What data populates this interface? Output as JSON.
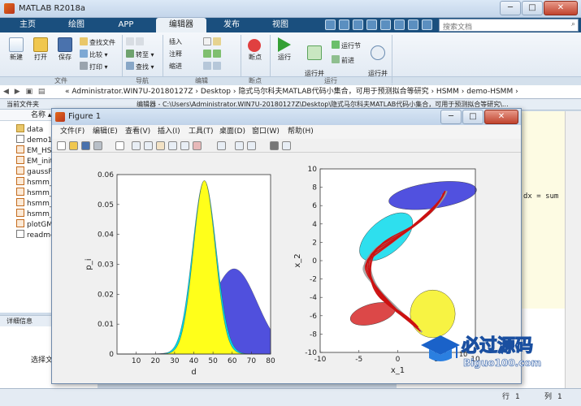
{
  "app": {
    "title": "MATLAB R2018a",
    "win_min": "─",
    "win_max": "□",
    "win_close": "✕"
  },
  "tabs": [
    "主页",
    "绘图",
    "APP",
    "编辑器",
    "发布",
    "视图"
  ],
  "search": {
    "placeholder": "搜索文档",
    "icon": "search-icon"
  },
  "ribbon": {
    "file": {
      "new": "新建",
      "open": "打开",
      "save": "保存",
      "find_files": "查找文件",
      "compare": "比较",
      "print": "打印",
      "label": "文件"
    },
    "nav": {
      "goto": "转至",
      "find": "查找",
      "label": "导航"
    },
    "edit": {
      "insert": "插入",
      "comment": "注释",
      "indent": "缩进",
      "label": "编辑"
    },
    "breakpoint": {
      "breakpoints": "断点",
      "label": "断点"
    },
    "run": {
      "run": "运行",
      "run_advance": "运行并\n前进",
      "run_section": "运行节",
      "advance": "前进",
      "run_time": "运行并\n计时",
      "label": "运行"
    }
  },
  "address": {
    "path": "« Administrator.WIN7U-20180127Z › Desktop › 隐式马尔科夫MATLAB代码小集合，可用于预测拟合等研究 › HSMM › demo-HSMM ›"
  },
  "folder": {
    "header": "当前文件夹",
    "col_name": "名称",
    "items": [
      {
        "name": "data",
        "kind": "folder"
      },
      {
        "name": "demo1",
        "kind": "file"
      },
      {
        "name": "EM_HS",
        "kind": "mat"
      },
      {
        "name": "EM_init",
        "kind": "mat"
      },
      {
        "name": "gaussP",
        "kind": "mat"
      },
      {
        "name": "hsmm_",
        "kind": "mat"
      },
      {
        "name": "hsmm_",
        "kind": "mat"
      },
      {
        "name": "hsmm_",
        "kind": "mat"
      },
      {
        "name": "hsmm_",
        "kind": "mat"
      },
      {
        "name": "plotGM",
        "kind": "mat"
      },
      {
        "name": "readme",
        "kind": "file"
      }
    ],
    "details_header": "详细信息",
    "details_text": "选择文"
  },
  "editor": {
    "tab_path": "编辑器 - C:\\Users\\Administrator.WIN7U-20180127Z\\Desktop\\隐式马尔科夫MATLAB代码小集合，可用于预测拟合等研究\\...",
    "code_snippet": "dx = sum"
  },
  "status": {
    "row_label": "行",
    "row_value": "1",
    "col_label": "列",
    "col_value": "1"
  },
  "figure": {
    "title": "Figure 1",
    "menu": [
      "文件(F)",
      "编辑(E)",
      "查看(V)",
      "插入(I)",
      "工具(T)",
      "桌面(D)",
      "窗口(W)",
      "帮助(H)"
    ]
  },
  "chart_data": [
    {
      "type": "area",
      "xlabel": "d",
      "ylabel": "p_i",
      "xlim": [
        0,
        80
      ],
      "ylim": [
        0,
        0.06
      ],
      "xticks": [
        10,
        20,
        30,
        40,
        50,
        60,
        70,
        80
      ],
      "yticks": [
        0,
        0.01,
        0.02,
        0.03,
        0.04,
        0.05,
        0.06
      ],
      "series": [
        {
          "color": "#1f1fd4",
          "mean": 61,
          "sd": 12,
          "peak": 0.0285
        },
        {
          "color": "#00d4e8",
          "mean": 45.5,
          "sd": 6.2,
          "peak": 0.058
        },
        {
          "color": "#ffff1a",
          "mean": 45.5,
          "sd": 5.7,
          "peak": 0.058
        }
      ]
    },
    {
      "type": "scatter",
      "xlabel": "x_1",
      "ylabel": "x_2",
      "xlim": [
        -10,
        10
      ],
      "ylim": [
        -10,
        10
      ],
      "xticks": [
        -10,
        -5,
        0,
        5,
        10
      ],
      "yticks": [
        -10,
        -8,
        -6,
        -4,
        -2,
        0,
        2,
        4,
        6,
        8,
        10
      ],
      "tick_suffix": "10",
      "ellipses": [
        {
          "cx": 4.5,
          "cy": 7.1,
          "rx": 5.7,
          "ry": 1.4,
          "angle": -8,
          "color": "#2b2bd8"
        },
        {
          "cx": -1.5,
          "cy": 2.6,
          "rx": 4.1,
          "ry": 1.8,
          "angle": -40,
          "color": "#00d8ea"
        },
        {
          "cx": 4.5,
          "cy": -5.8,
          "rx": 2.9,
          "ry": 2.6,
          "angle": 0,
          "color": "#f5f01a"
        },
        {
          "cx": -3.2,
          "cy": -5.8,
          "rx": 3.0,
          "ry": 1.1,
          "angle": -15,
          "color": "#d42020"
        }
      ],
      "colors": {
        "gray": "#999999",
        "red": "#cc1111"
      }
    }
  ],
  "watermark": {
    "cn": "必过源码",
    "url": "Biguo100.com"
  }
}
